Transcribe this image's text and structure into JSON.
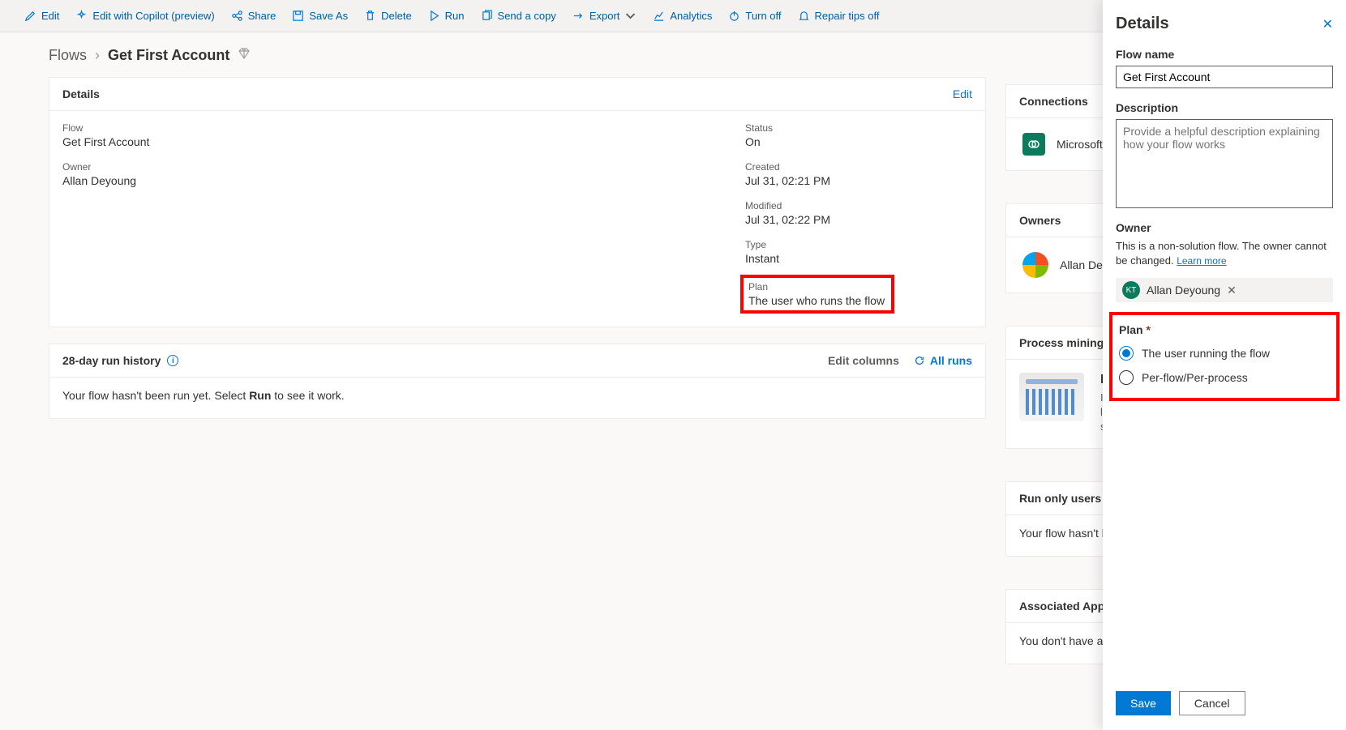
{
  "toolbar": {
    "edit": "Edit",
    "edit_copilot": "Edit with Copilot (preview)",
    "share": "Share",
    "save_as": "Save As",
    "delete": "Delete",
    "run": "Run",
    "send_copy": "Send a copy",
    "export": "Export",
    "analytics": "Analytics",
    "turn_off": "Turn off",
    "repair_tips": "Repair tips off"
  },
  "breadcrumb": {
    "root": "Flows",
    "current": "Get First Account"
  },
  "details_card": {
    "title": "Details",
    "edit_link": "Edit",
    "flow_label": "Flow",
    "flow_value": "Get First Account",
    "owner_label": "Owner",
    "owner_value": "Allan Deyoung",
    "status_label": "Status",
    "status_value": "On",
    "created_label": "Created",
    "created_value": "Jul 31, 02:21 PM",
    "modified_label": "Modified",
    "modified_value": "Jul 31, 02:22 PM",
    "type_label": "Type",
    "type_value": "Instant",
    "plan_label": "Plan",
    "plan_value": "The user who runs the flow"
  },
  "run_history": {
    "title": "28-day run history",
    "edit_columns": "Edit columns",
    "all_runs": "All runs",
    "empty_prefix": "Your flow hasn't been run yet. Select ",
    "empty_bold": "Run",
    "empty_suffix": " to see it work."
  },
  "connections": {
    "title": "Connections",
    "items": [
      {
        "name": "Microsoft Dataverse"
      }
    ]
  },
  "owners_card": {
    "title": "Owners",
    "owner": "Allan Deyoung"
  },
  "process_mining": {
    "title": "Process mining (preview)",
    "heading": "Improve your flow",
    "desc": "Import your flow's run history, then learn how to optimize your automated suggestions."
  },
  "run_only": {
    "title": "Run only users",
    "empty": "Your flow hasn't been shared with anyone."
  },
  "associated_apps": {
    "title": "Associated Apps",
    "empty": "You don't have any apps associated with this flow."
  },
  "panel": {
    "title": "Details",
    "flow_name_label": "Flow name",
    "flow_name_value": "Get First Account",
    "description_label": "Description",
    "description_placeholder": "Provide a helpful description explaining how your flow works",
    "owner_label": "Owner",
    "owner_note": "This is a non-solution flow. The owner cannot be changed.",
    "learn_more": "Learn more",
    "owner_initials": "KT",
    "owner_name": "Allan Deyoung",
    "plan_label": "Plan",
    "plan_opt1": "The user running the flow",
    "plan_opt2": "Per-flow/Per-process",
    "save": "Save",
    "cancel": "Cancel"
  }
}
